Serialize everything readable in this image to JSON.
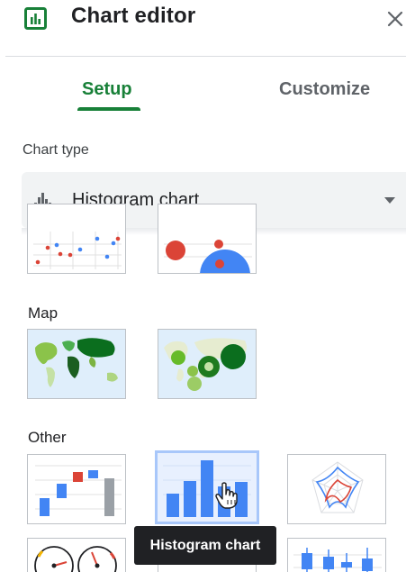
{
  "header": {
    "title": "Chart editor",
    "app_icon": "chart-bar-square-icon",
    "close_icon": "close-icon"
  },
  "tabs": [
    {
      "label": "Setup",
      "active": true
    },
    {
      "label": "Customize",
      "active": false
    }
  ],
  "chart_type": {
    "section_label": "Chart type",
    "selected_value": "Histogram chart",
    "selected_icon": "histogram-icon",
    "caret_icon": "caret-down-icon"
  },
  "groups": {
    "map": {
      "label": "Map"
    },
    "other": {
      "label": "Other"
    }
  },
  "tooltip": {
    "text": "Histogram chart"
  },
  "colors": {
    "accent_green": "#188038",
    "blue": "#4285f4",
    "red": "#db4437",
    "gray": "#9aa0a6",
    "map_green_dark": "#0b6e1e",
    "selected_border": "#a8c7fa"
  }
}
